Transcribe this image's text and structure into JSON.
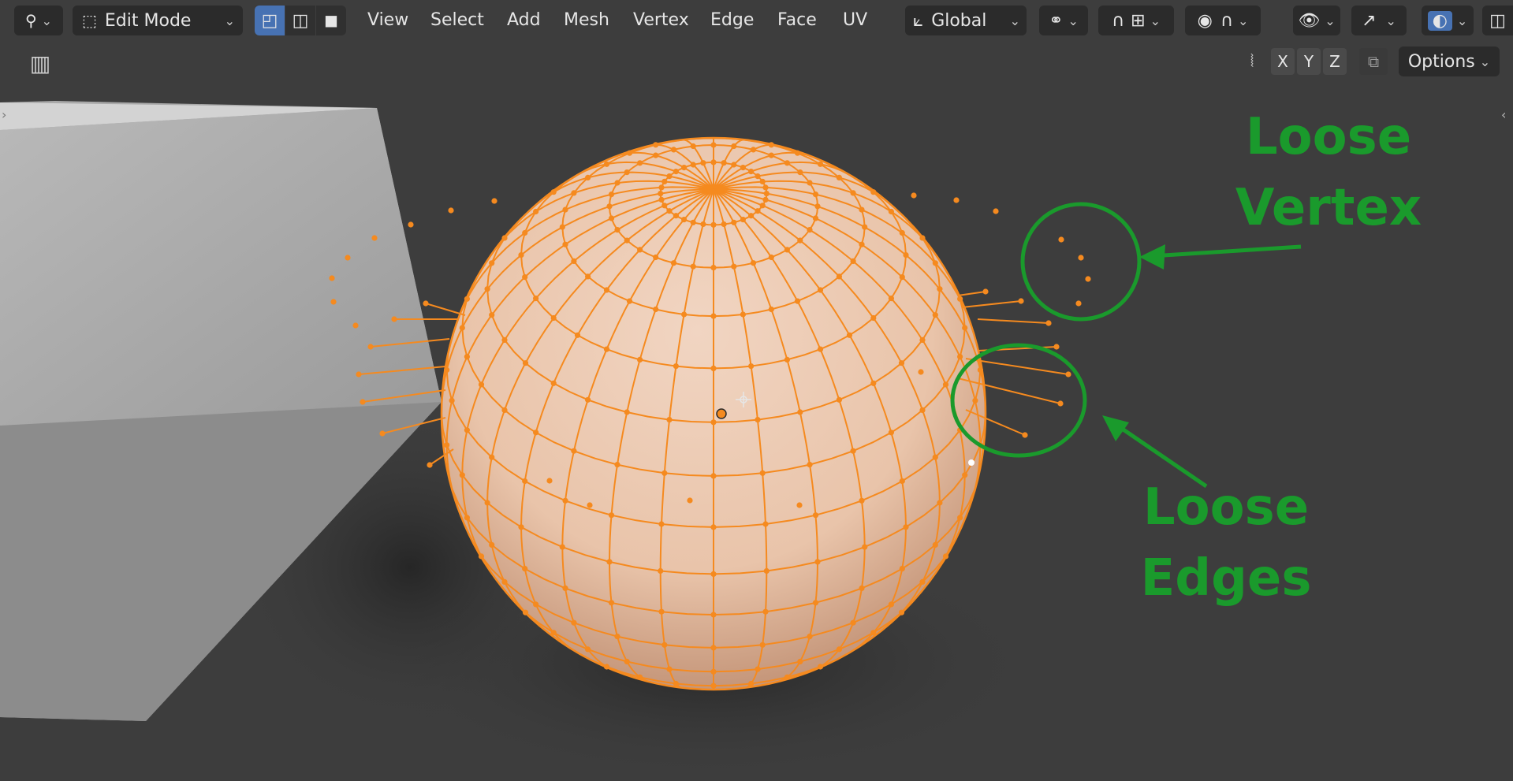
{
  "header": {
    "mode_label": "Edit Mode",
    "menus": [
      "View",
      "Select",
      "Add",
      "Mesh",
      "Vertex",
      "Edge",
      "Face",
      "UV"
    ],
    "orientation_label": "Global",
    "options_label": "Options",
    "axes": [
      "X",
      "Y",
      "Z"
    ]
  },
  "annotations": {
    "loose_vertex": [
      "Loose",
      "Vertex"
    ],
    "loose_edges": [
      "Loose",
      "Edges"
    ]
  },
  "colors": {
    "background": "#3d3d3d",
    "toolbar": "#2b2b2b",
    "accent_blue": "#4772b3",
    "mesh_orange": "#f58a1f",
    "sphere_fill": "#e9c6ad",
    "annotation_green": "#1a9a2c"
  },
  "icons": {
    "editor_type": "tool-icon",
    "mode": "mesh-edit-icon",
    "select_modes": [
      "vertex-select-icon",
      "edge-select-icon",
      "face-select-icon"
    ],
    "transform": "transform-orientation-icon",
    "pivot": "pivot-icon",
    "snap": "snap-icon",
    "proportional": "proportional-edit-icon",
    "visibility": "viewport-visibility-icon",
    "gizmo": "gizmo-icon",
    "overlay": "overlay-icon",
    "xray": "xray-icon"
  }
}
